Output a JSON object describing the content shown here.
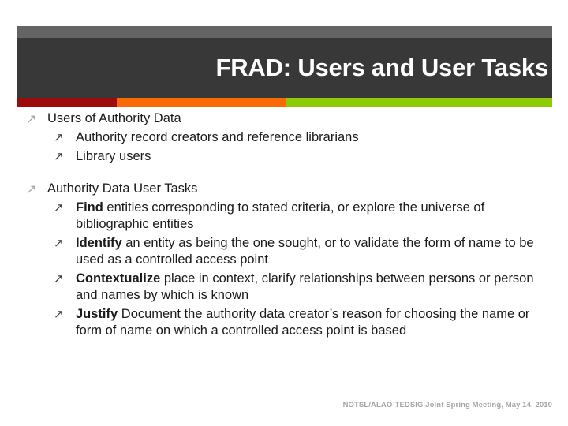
{
  "slide": {
    "title": "FRAD: Users and User Tasks",
    "bullet_glyph": "↗",
    "colors": {
      "header_top_strip": "#646464",
      "header_body": "#383838",
      "accent_red": "#9e0b0b",
      "accent_orange": "#f96a07",
      "accent_green": "#8fcb05",
      "title_text": "#ffffff",
      "body_text": "#1a1a1a",
      "level1_bullet": "#a6a6a6",
      "level2_bullet": "#3a3a3a",
      "footer_text": "#a6a6a6"
    },
    "sections": [
      {
        "heading": "Users of Authority Data",
        "items": [
          {
            "lead": "",
            "rest": "Authority record creators and reference librarians"
          },
          {
            "lead": "",
            "rest": "Library users"
          }
        ]
      },
      {
        "heading": "Authority Data User Tasks",
        "items": [
          {
            "lead": "Find",
            "rest": " entities corresponding to stated criteria, or explore the universe of bibliographic entities"
          },
          {
            "lead": "Identify",
            "rest": " an entity as being the one sought, or to validate the form of name to be used as a controlled access point"
          },
          {
            "lead": "Contextualize",
            "rest": " place in context, clarify relationships between persons or person and names by which is known"
          },
          {
            "lead": "Justify",
            "rest": " Document the authority data creator’s reason for choosing the name or form of name on which a controlled access point is based"
          }
        ]
      }
    ],
    "footer": "NOTSL/ALAO-TEDSIG Joint Spring Meeting, May 14, 2010"
  }
}
